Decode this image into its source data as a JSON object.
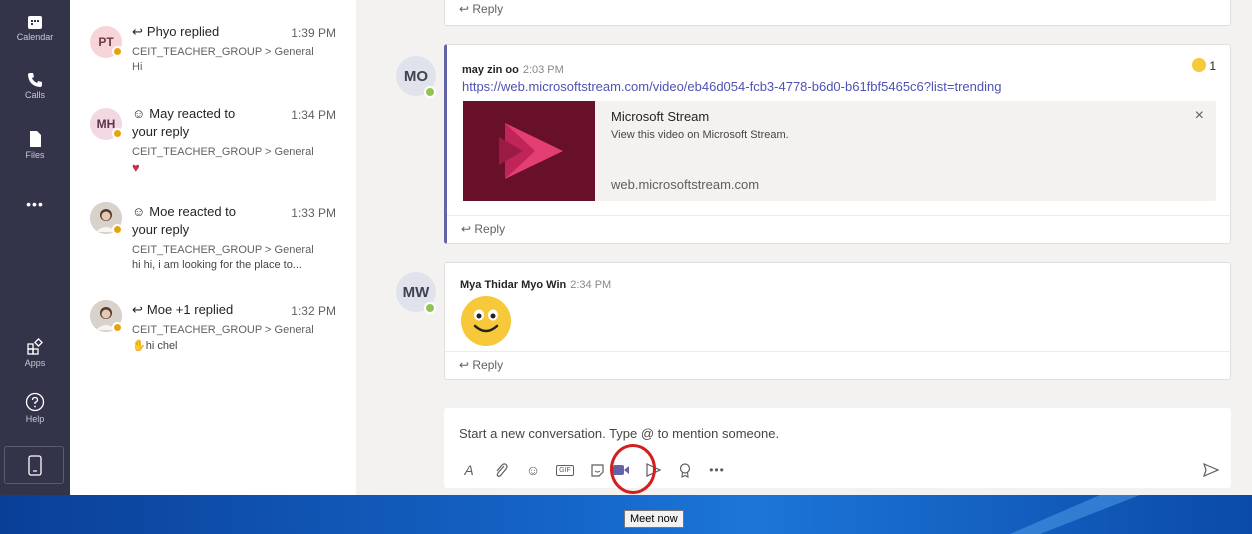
{
  "rail": {
    "items": [
      {
        "label": "Calendar",
        "icon": "calendar-icon"
      },
      {
        "label": "Calls",
        "icon": "phone-icon"
      },
      {
        "label": "Files",
        "icon": "file-icon"
      },
      {
        "label": "•••",
        "icon": "more-icon"
      },
      {
        "label": "Apps",
        "icon": "apps-icon"
      },
      {
        "label": "Help",
        "icon": "help-icon"
      }
    ]
  },
  "feed": {
    "items": [
      {
        "initials": "PT",
        "title": "Phyo replied",
        "time": "1:39 PM",
        "path": "CEIT_TEACHER_GROUP > General",
        "body": "Hi",
        "avatar_color": "#f7d4d8",
        "icon": "reply-arrow-icon"
      },
      {
        "initials": "MH",
        "title": "May reacted to",
        "title2": "your reply",
        "time": "1:34 PM",
        "path": "CEIT_TEACHER_GROUP > General",
        "body": "♥",
        "avatar_color": "#f1d8e3",
        "icon": "reaction-smile-icon"
      },
      {
        "initials": "",
        "title": "Moe reacted to",
        "title2": "your reply",
        "time": "1:33 PM",
        "path": "CEIT_TEACHER_GROUP > General",
        "body": "hi hi, i am looking for the place to...",
        "avatar_color": "#d9d2cb",
        "icon": "reaction-smile-icon"
      },
      {
        "initials": "",
        "title": "Moe +1 replied",
        "time": "1:32 PM",
        "path": "CEIT_TEACHER_GROUP > General",
        "body": "hi chel",
        "avatar_color": "#d9d2cb",
        "icon": "reply-arrow-icon"
      }
    ]
  },
  "thread": {
    "top_reply": "Reply",
    "msg1": {
      "initials": "MO",
      "author": "may zin oo",
      "time": "2:03 PM",
      "link": "https://web.microsoftstream.com/video/eb46d054-fcb3-4778-b6d0-b61fbf5465c6?list=trending",
      "reaction_count": "1",
      "preview_title": "Microsoft Stream",
      "preview_desc": "View this video on Microsoft Stream.",
      "preview_domain": "web.microsoftstream.com",
      "reply": "Reply"
    },
    "msg2": {
      "initials": "MW",
      "author": "Mya Thidar Myo Win",
      "time": "2:34 PM",
      "reply": "Reply"
    }
  },
  "compose": {
    "placeholder": "Start a new conversation. Type @ to mention someone.",
    "gif_label": "GIF",
    "more_label": "•••"
  },
  "tooltip": "Meet now",
  "colors": {
    "rail": "#33344a",
    "accent": "#4f52b2",
    "meet_circle": "#d21f1f"
  }
}
